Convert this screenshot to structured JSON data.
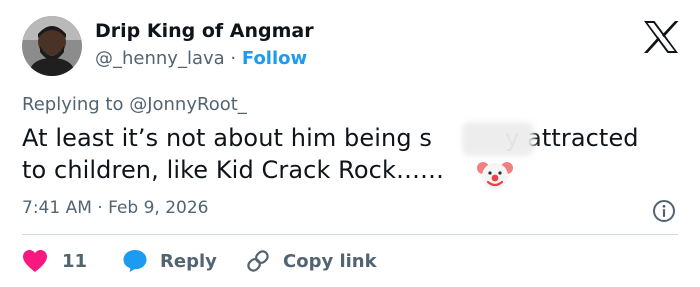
{
  "author": {
    "display_name": "Drip King of Angmar",
    "handle": "@_henny_lava",
    "separator": "·",
    "follow_label": "Follow"
  },
  "reply_context": {
    "prefix": "Replying to ",
    "mention": "@JonnyRoot_"
  },
  "tweet": {
    "line1_before": "At least it’s not about him being s",
    "line1_after": "y attracted",
    "line2": "to children, like Kid Crack Rock……"
  },
  "meta": {
    "time": "7:41 AM",
    "separator": "·",
    "date": "Feb 9, 2026"
  },
  "actions": {
    "likes_count": "11",
    "reply_label": "Reply",
    "copy_link_label": "Copy link"
  },
  "colors": {
    "text_primary": "#0f1419",
    "text_secondary": "#536471",
    "link_blue": "#1d9bf0",
    "like_pink": "#f91880",
    "reply_blue": "#1d9bf0",
    "divider": "#cfd9de"
  },
  "icons": {
    "logo": "x-logo-icon",
    "info": "info-icon",
    "like": "heart-icon",
    "reply": "speech-bubble-icon",
    "copy_link": "link-icon",
    "emoji": "clown-face-emoji"
  }
}
